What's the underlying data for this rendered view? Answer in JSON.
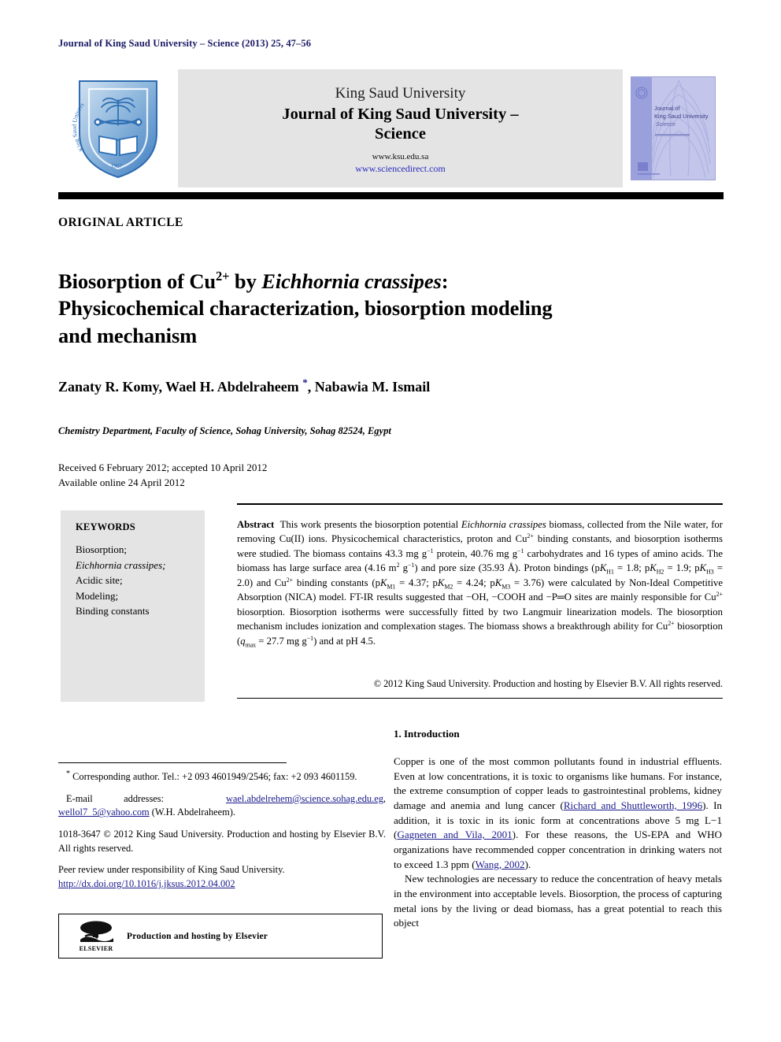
{
  "running_head": "Journal of King Saud University – Science (2013) 25, 47–56",
  "masthead": {
    "logo_alt": "King Saud University shield logo",
    "university": "King Saud University",
    "journal_name_line1": "Journal of King Saud University –",
    "journal_name_line2": "Science",
    "url_ksu": "www.ksu.edu.sa",
    "url_sciencedirect": "www.sciencedirect.com",
    "cover_title_line1": "Journal of",
    "cover_title_line2": "King Saud University",
    "cover_title_line3": "Science"
  },
  "article_type": "ORIGINAL ARTICLE",
  "title": {
    "line1_a": "Biosorption of Cu",
    "line1_sup": "2+",
    "line1_b": " by ",
    "line1_italic": "Eichhornia crassipes",
    "line1_c": ":",
    "line2": "Physicochemical characterization, biosorption modeling",
    "line3": "and mechanism"
  },
  "authors": {
    "text_before_star": "Zanaty R. Komy, Wael H. Abdelraheem ",
    "star": "*",
    "text_after_star": ", Nabawia M. Ismail"
  },
  "affiliation": "Chemistry Department, Faculty of Science, Sohag University, Sohag 82524, Egypt",
  "dates": {
    "received": "Received 6 February 2012; accepted 10 April 2012",
    "available": "Available online 24 April 2012"
  },
  "keywords": {
    "heading": "KEYWORDS",
    "items": [
      {
        "text": "Biosorption;",
        "italic": false
      },
      {
        "text": "Eichhornia crassipes;",
        "italic": true
      },
      {
        "text": "Acidic site;",
        "italic": false
      },
      {
        "text": "Modeling;",
        "italic": false
      },
      {
        "text": "Binding constants",
        "italic": false
      }
    ]
  },
  "abstract": {
    "label": "Abstract",
    "body": "This work presents the biosorption potential Eichhornia crassipes biomass, collected from the Nile water, for removing Cu(II) ions. Physicochemical characteristics, proton and Cu2+ binding constants, and biosorption isotherms were studied. The biomass contains 43.3 mg g−1 protein, 40.76 mg g−1 carbohydrates and 16 types of amino acids. The biomass has large surface area (4.16 m2 g−1) and pore size (35.93 Å). Proton bindings (pKH1 = 1.8; pKH2 = 1.9; pKH3 = 2.0) and Cu2+ binding constants (pKM1 = 4.37; pKM2 = 4.24; pKM3 = 3.76) were calculated by Non-Ideal Competitive Absorption (NICA) model. FT-IR results suggested that −OH, −COOH and −P═O sites are mainly responsible for Cu2+ biosorption. Biosorption isotherms were successfully fitted by two Langmuir linearization models. The biosorption mechanism includes ionization and complexation stages. The biomass shows a breakthrough ability for Cu2+ biosorption (qmax = 27.7 mg g−1) and at pH 4.5.",
    "copyright": "© 2012 King Saud University. Production and hosting by Elsevier B.V. All rights reserved."
  },
  "footnotes": {
    "corresponding": "Corresponding author. Tel.: +2 093 4601949/2546; fax: +2 093 4601159.",
    "email_label": "E-mail addresses:",
    "email1": "wael.abdelrehem@science.sohag.edu.eg",
    "email2": "wellol7_5@yahoo.com",
    "email_owner": "(W.H. Abdelraheem).",
    "issn_line": "1018-3647 © 2012 King Saud University. Production and hosting by Elsevier B.V. All rights reserved.",
    "peer_review": "Peer review under responsibility of King Saud University.",
    "doi": "http://dx.doi.org/10.1016/j.jksus.2012.04.002",
    "elsevier_badge": "Production and hosting by Elsevier",
    "elsevier_word": "ELSEVIER"
  },
  "introduction": {
    "heading": "1. Introduction",
    "paragraph1_a": "Copper is one of the most common pollutants found in industrial effluents. Even at low concentrations, it is toxic to organisms like humans. For instance, the extreme consumption of copper leads to gastrointestinal problems, kidney damage and anemia and lung cancer (",
    "ref1": "Richard and Shuttleworth, 1996",
    "paragraph1_b": "). In addition, it is toxic in its ionic form at concentrations above 5 mg L−1 (",
    "ref2": "Gagneten and Vila, 2001",
    "paragraph1_c": "). For these reasons, the US-EPA and WHO organizations have recommended copper concentration in drinking waters not to exceed 1.3 ppm (",
    "ref3": "Wang, 2002",
    "paragraph1_d": ").",
    "paragraph2": "New technologies are necessary to reduce the concentration of heavy metals in the environment into acceptable levels. Biosorption, the process of capturing metal ions by the living or dead biomass, has a great potential to reach this object"
  },
  "colors": {
    "link_blue": "#1a1a8c",
    "header_navy": "#1a1a66",
    "box_gray": "#e4e4e4",
    "shield_blue": "#3f7cc0",
    "cover_purple": "#b6b9e4"
  }
}
